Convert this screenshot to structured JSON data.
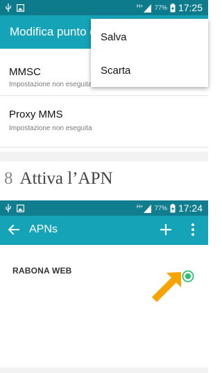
{
  "status_bar_top": {
    "battery": "77%",
    "time": "17:25",
    "icons": [
      "usb-icon",
      "image-icon",
      "hplus-signal-icon",
      "battery-icon"
    ]
  },
  "top_screen": {
    "title": "Modifica punto d",
    "settings": [
      {
        "title": "MMSC",
        "subtitle": "Impostazione non eseguita"
      },
      {
        "title": "Proxy MMS",
        "subtitle": "Impostazione non eseguita"
      }
    ],
    "menu": {
      "save_label": "Salva",
      "discard_label": "Scarta"
    }
  },
  "step": {
    "number": "8",
    "text": "Attiva l’APN"
  },
  "status_bar_bottom": {
    "battery": "77%",
    "time": "17:24"
  },
  "bottom_screen": {
    "title": "APNs",
    "apn_items": [
      {
        "name": "RABONA WEB",
        "selected": true
      }
    ],
    "colors": {
      "appbar": "#15a3b8",
      "statusbar": "#0e7b8c",
      "radio_selected": "#2fbf71",
      "arrow": "#f7a400"
    }
  }
}
